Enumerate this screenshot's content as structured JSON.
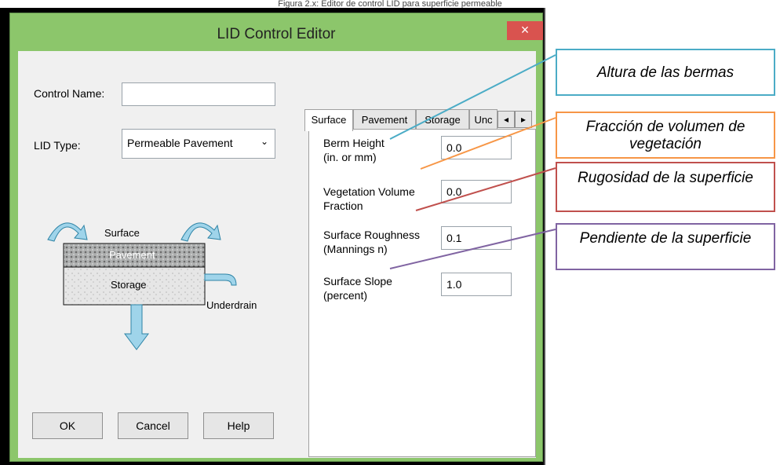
{
  "caption": "Figura 2.x: Editor de control LID para superficie permeable",
  "window": {
    "title": "LID Control Editor",
    "close_glyph": "×"
  },
  "form": {
    "control_name_label": "Control Name:",
    "control_name_value": "",
    "lid_type_label": "LID Type:",
    "lid_type_value": "Permeable Pavement"
  },
  "diagram": {
    "surface": "Surface",
    "pavement": "Pavement",
    "storage": "Storage",
    "underdrain": "Underdrain"
  },
  "tabs": [
    "Surface",
    "Pavement",
    "Storage",
    "Unc"
  ],
  "fields": [
    {
      "label1": "Berm Height",
      "label2": "(in. or mm)",
      "value": "0.0"
    },
    {
      "label1": "Vegetation Volume",
      "label2": "Fraction",
      "value": "0.0"
    },
    {
      "label1": "Surface Roughness",
      "label2": "(Mannings n)",
      "value": "0.1"
    },
    {
      "label1": "Surface Slope",
      "label2": "(percent)",
      "value": "1.0"
    }
  ],
  "buttons": {
    "ok": "OK",
    "cancel": "Cancel",
    "help": "Help"
  },
  "annotations": [
    {
      "text": "Altura de las bermas",
      "color": "#4bacc6"
    },
    {
      "text": "Fracción de volumen de vegetación",
      "color": "#f79646"
    },
    {
      "text": "Rugosidad de la superficie",
      "color": "#c0504d"
    },
    {
      "text": "Pendiente de la superficie",
      "color": "#8064a2"
    }
  ],
  "icons": [
    "close-icon",
    "chevron-down-icon",
    "tab-scroll-left-icon",
    "tab-scroll-right-icon",
    "curved-arrow-icon",
    "down-arrow-icon"
  ]
}
